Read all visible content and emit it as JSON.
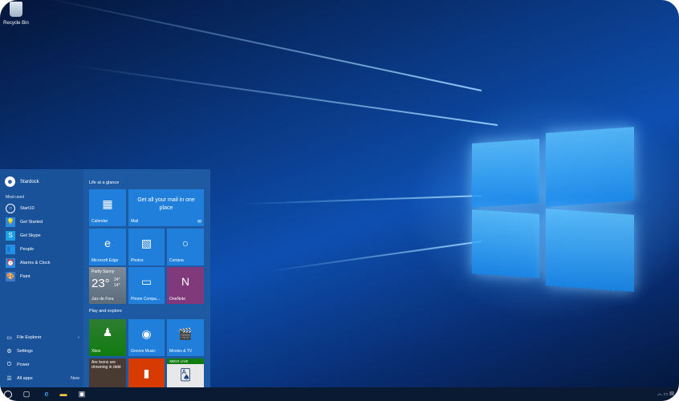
{
  "desktop": {
    "recycle_bin_label": "Recycle Bin"
  },
  "start_menu": {
    "user_name": "Stardock",
    "most_used_header": "Most used",
    "most_used": [
      {
        "label": "Start10",
        "icon": "start10-icon"
      },
      {
        "label": "Get Started",
        "icon": "lightbulb-icon"
      },
      {
        "label": "Get Skype",
        "icon": "skype-icon"
      },
      {
        "label": "People",
        "icon": "people-icon"
      },
      {
        "label": "Alarms & Clock",
        "icon": "alarm-clock-icon"
      },
      {
        "label": "Paint",
        "icon": "paint-icon"
      }
    ],
    "system": {
      "file_explorer": "File Explorer",
      "settings": "Settings",
      "power": "Power",
      "all_apps": "All apps",
      "all_apps_badge": "New"
    },
    "groups": {
      "life": "Life at a glance",
      "play": "Play and explore"
    },
    "tiles": {
      "calendar": "Calendar",
      "mail": "Mail",
      "mail_text": "Get all your mail in one place",
      "edge": "Microsoft Edge",
      "photos": "Photos",
      "cortana": "Cortana",
      "weather_condition": "Partly Sunny",
      "weather_temp": "23°",
      "weather_high": "24°",
      "weather_low": "14°",
      "weather_city": "Juiz de Fora",
      "phone": "Phone Compa...",
      "onenote": "OneNote",
      "xbox": "Xbox",
      "groove": "Groove Music",
      "movies": "Movies & TV",
      "news_text": "Are teens are drowning in debt",
      "xbox_live_badge": "XBOX LIVE"
    }
  },
  "colors": {
    "tile_blue": "#1f7fdb",
    "tile_green": "#107c10",
    "tile_purple": "#80397b",
    "tile_orange": "#d83b01",
    "start_bg": "#1d5aa3",
    "taskbar_bg": "#0b1a33"
  }
}
